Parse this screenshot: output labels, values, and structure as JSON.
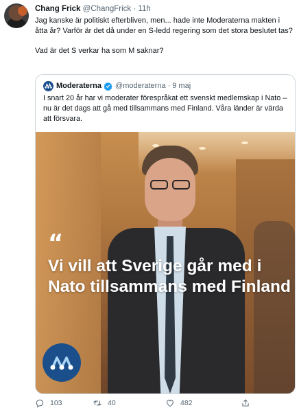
{
  "author": {
    "name": "Chang Frick",
    "handle": "@ChangFrick",
    "separator": "·",
    "time": "11h"
  },
  "tweet": {
    "paragraphs": [
      "Jag kanske är politiskt efterbliven, men... hade inte Moderaterna makten i åtta år? Varför är det då under en S-ledd regering som det stora beslutet tas?",
      "Vad är det S verkar ha som M saknar?"
    ]
  },
  "quoted": {
    "name": "Moderaterna",
    "verified": true,
    "handle": "@moderaterna",
    "separator": "·",
    "time": "9 maj",
    "text": "I snart 20 år har vi moderater förespråkat ett svenskt medlemskap i Nato – nu är det dags att gå med tillsammans med Finland. Våra länder är värda att försvara.",
    "image": {
      "quote_mark": "“",
      "headline": "Vi vill att Sverige går med i Nato tillsammans med Finland",
      "logo_color": "#1b4f8c"
    }
  },
  "actions": {
    "replies": "103",
    "retweets": "40",
    "likes": "482"
  },
  "colors": {
    "verified": "#1d9bf0",
    "secondary_text": "#536471",
    "border": "#cfd9de"
  }
}
